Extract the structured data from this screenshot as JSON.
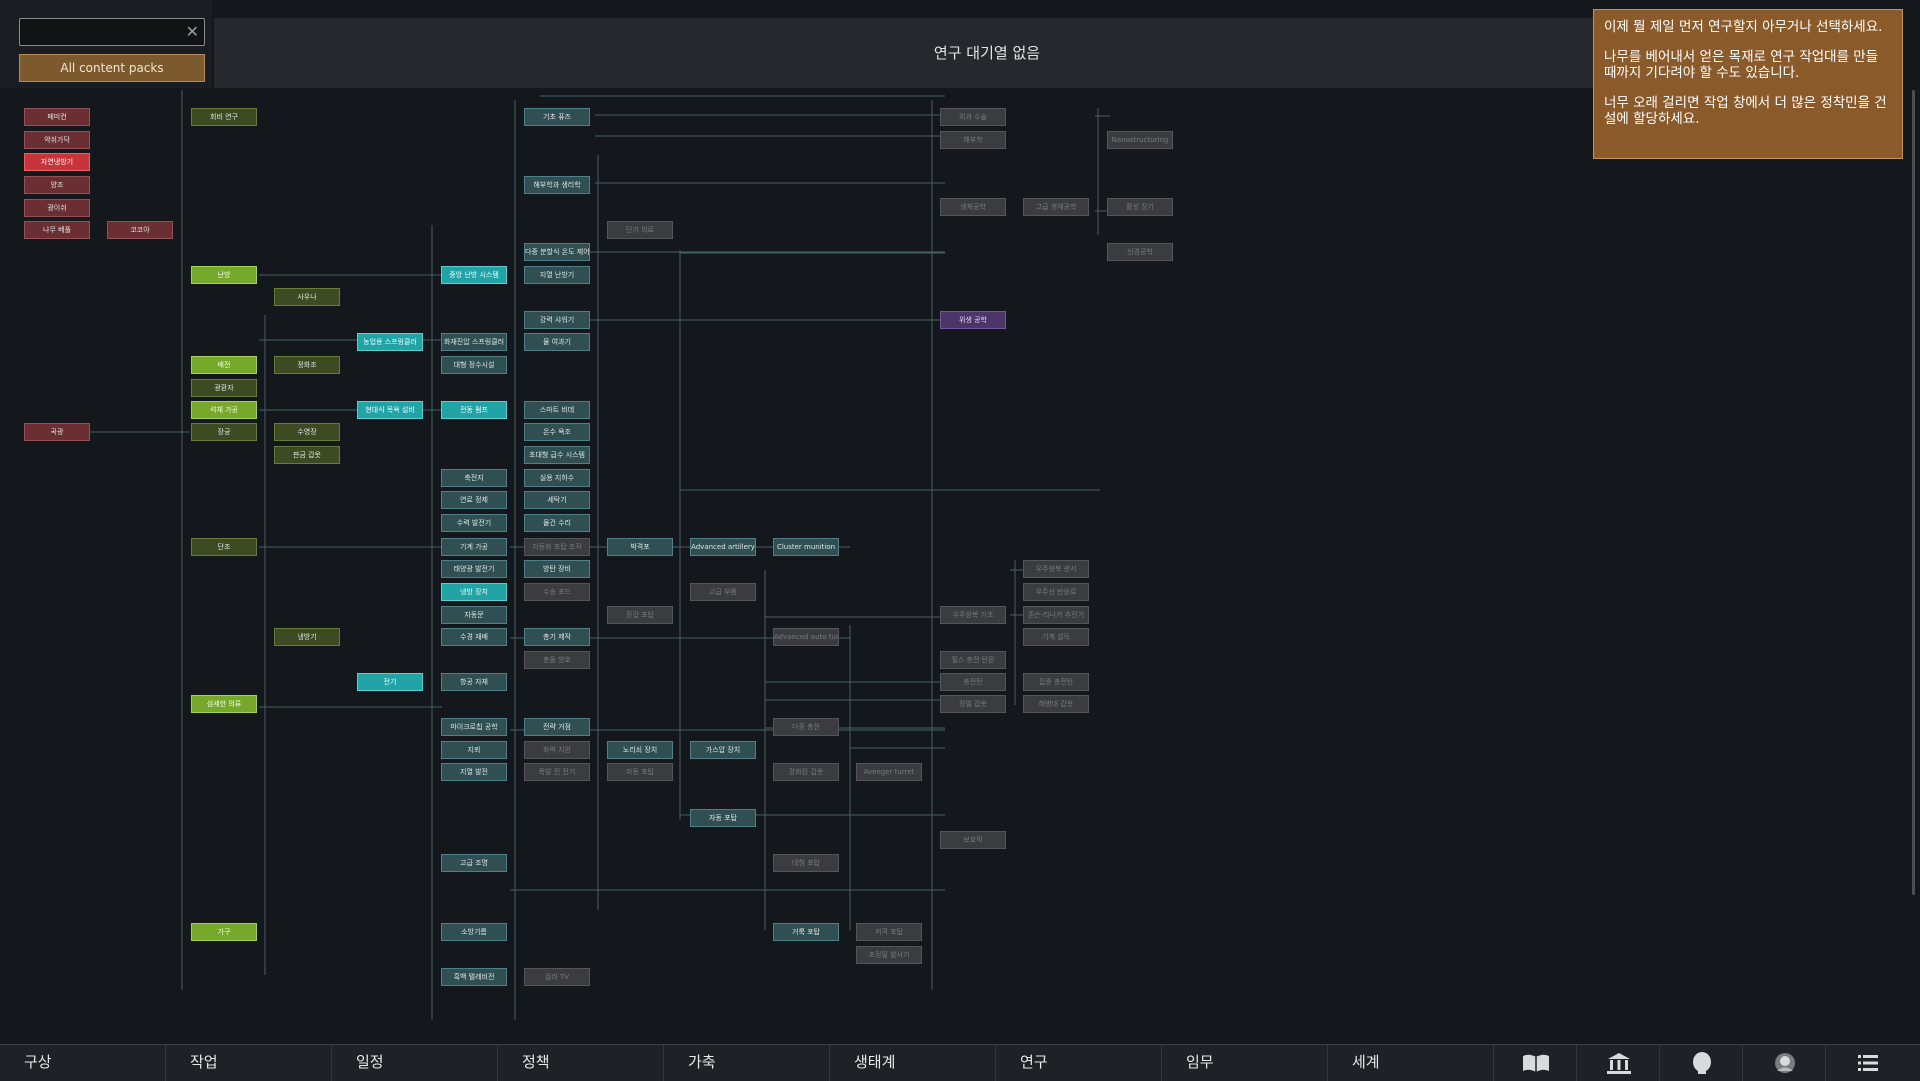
{
  "search": {
    "value": "",
    "placeholder": ""
  },
  "content_packs_label": "All content packs",
  "queue_title": "연구 대기열 없음",
  "tooltip": {
    "p1": "이제 뭘 제일 먼저 연구할지 아무거나 선택하세요.",
    "p2": "나무를 베어내서 얻은 목재로 연구 작업대를 만들 때까지 기다려야 할 수도 있습니다.",
    "p3": "너무 오래 걸리면 작업 창에서 더 많은 정착민을 건설에 할당하세요."
  },
  "colors": {
    "teal": "#2f4f53",
    "cyan": "#22a4a6",
    "green": "#76a82c",
    "olive": "#3d4a22",
    "red": "#6b2e33",
    "bright_red": "#c8343a",
    "gray": "#3a3c3f",
    "purple": "#4c3569",
    "tooltip_bg": "#8a5a2a",
    "line": "#4d6f72"
  },
  "nodes": {
    "n1": "페미컨",
    "n2": "약쉬가닥",
    "n3": "자연냉방기",
    "n4": "양조",
    "n5": "광이쉬",
    "n6": "나무 베풀",
    "n7": "코코아",
    "n8": "곡광",
    "n9": "회비 연구",
    "n10": "난방",
    "n11": "배전",
    "n12": "광환자",
    "n13": "석재 가공",
    "n14": "장궁",
    "n15": "단조",
    "n16": "섬세한 의류",
    "n17": "가구",
    "n18": "사우나",
    "n19": "정화조",
    "n20": "수영장",
    "n21": "판금 갑옷",
    "n22": "냉방기",
    "n23": "농업용 스프링클러",
    "n24": "현대식 목욕 설비",
    "n25": "전기",
    "n26": "중앙 난방 시스템",
    "n27": "화재진압 스프링클러",
    "n28": "대형 정수시설",
    "n29": "전동 펌프",
    "n30": "축전지",
    "n31": "연료 정제",
    "n32": "수력 발전기",
    "n33": "기계 가공",
    "n34": "태양광 발전기",
    "n35": "냉방 장치",
    "n36": "자동문",
    "n37": "수경 재배",
    "n38": "항공 자재",
    "n39": "마이크로칩 공학",
    "n40": "지뢰",
    "n41": "지열 발전",
    "n42": "고급 조명",
    "n43": "소방기름",
    "n44": "흑백 텔레비전",
    "n45": "기초 퓨즈",
    "n46": "해부학과 생리학",
    "n47": "다중 분할식 온도 제어",
    "n48": "지열 난방기",
    "n49": "강력 샤워기",
    "n50": "물 여과기",
    "n51": "스마트 비데",
    "n52": "온수 욕조",
    "n53": "초대형 급수 시스템",
    "n54": "실용 지하수",
    "n55": "세탁기",
    "n56": "물건 수리",
    "n57": "자동화 포탑 조작",
    "n58": "방탄 장비",
    "n59": "수송 포드",
    "n60": "총기 제작",
    "n61": "충돌 방호",
    "n62": "전략 거점",
    "n63": "화력 지원",
    "n64": "폭발 전 전기",
    "n65": "컬러 TV",
    "n66": "단기 의료",
    "n67": "박격포",
    "n68": "장갑 포탑",
    "n69": "노리쇠 장치",
    "n70": "자동 포탑",
    "n71": "Advanced artillery",
    "n72": "고급 부품",
    "n73": "가스압 장치",
    "n74": "Cluster munition",
    "n75": "Advanced auto turret",
    "n76": "다중 충전",
    "n77": "강화된 갑옷",
    "n78": "대형 포탑",
    "n79": "거룩 포탑",
    "n80": "Avenger turret",
    "n81": "저격 포탑",
    "n82": "초정밀 발사기",
    "n83": "외과 수술",
    "n84": "해부학",
    "n85": "생체공학",
    "n86": "위생 공학",
    "n87": "우주왕복 기초",
    "n88": "펄스 충전 탄환",
    "n89": "충전탄",
    "n90": "정밀 갑옷",
    "n91": "보호막",
    "n92": "고급 생체공학",
    "n93": "우주왕복 센서",
    "n94": "우주선 반응로",
    "n95": "존슨-타나카 추진기",
    "n96": "기계 설득",
    "n97": "집중 충전탄",
    "n98": "해병대 갑옷",
    "n99": "Nanostructuring",
    "n100": "활성 장기",
    "n101": "신경공학"
  }
}
